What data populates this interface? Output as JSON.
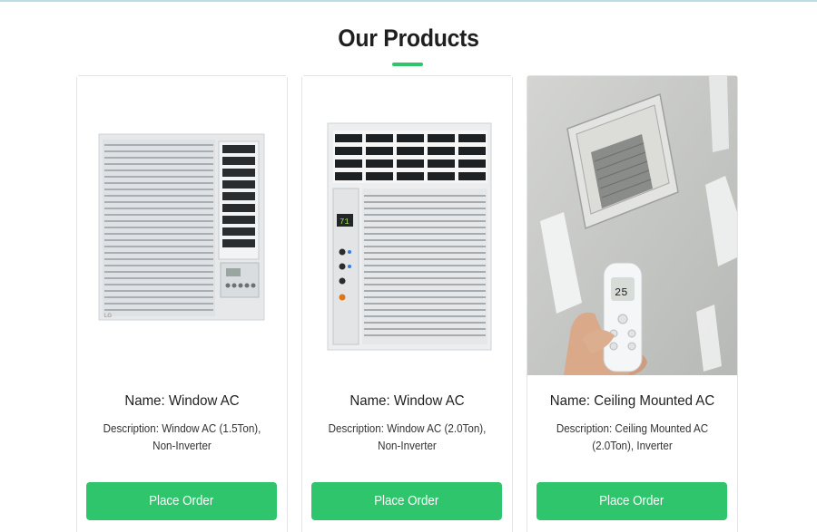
{
  "section": {
    "title": "Our Products"
  },
  "products": [
    {
      "name": "Name: Window AC",
      "description": "Description: Window AC (1.5Ton), Non-Inverter",
      "button_label": "Place Order",
      "image_icon": "window-ac-icon"
    },
    {
      "name": "Name: Window AC",
      "description": "Description: Window AC (2.0Ton), Non-Inverter",
      "button_label": "Place Order",
      "image_icon": "window-ac-icon"
    },
    {
      "name": "Name: Ceiling Mounted AC",
      "description": "Description: Ceiling Mounted AC (2.0Ton), Inverter",
      "button_label": "Place Order",
      "image_icon": "ceiling-ac-icon"
    }
  ],
  "colors": {
    "accent": "#2fc56c",
    "card_border": "#e3e3e3",
    "top_line": "#b9dde3"
  }
}
